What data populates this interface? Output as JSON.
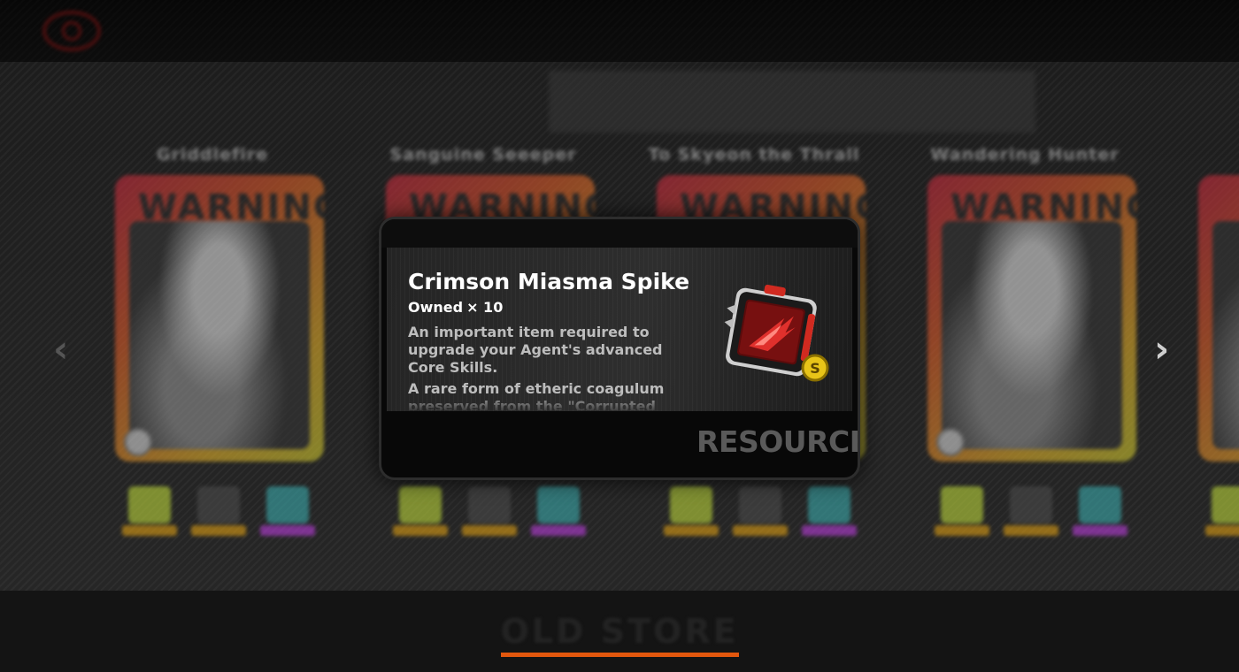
{
  "dialog": {
    "item_name": "Crimson Miasma Spike",
    "owned_label": "Owned",
    "owned_count": "× 10",
    "description": [
      "An important item required to upgrade your Agent's advanced Core Skills.",
      "A rare form of etheric coagulum preserved from the \"Corrupted"
    ],
    "category": "RESOURCE",
    "item_icon": "crimson-spike-item-icon",
    "rank_badge": "S"
  },
  "cards": [
    {
      "name": "Griddlefire"
    },
    {
      "name": "Sanguine Seeeper"
    },
    {
      "name": "To Skyeon the Thrall"
    },
    {
      "name": "Wandering Hunter"
    },
    {
      "name": ""
    }
  ],
  "card_art_text": "WARNING",
  "bottom_tab": {
    "label": "OLD STORE"
  },
  "colors": {
    "accent": "#e2570d",
    "modal_bg": "#080808",
    "text_primary": "#ffffff"
  }
}
